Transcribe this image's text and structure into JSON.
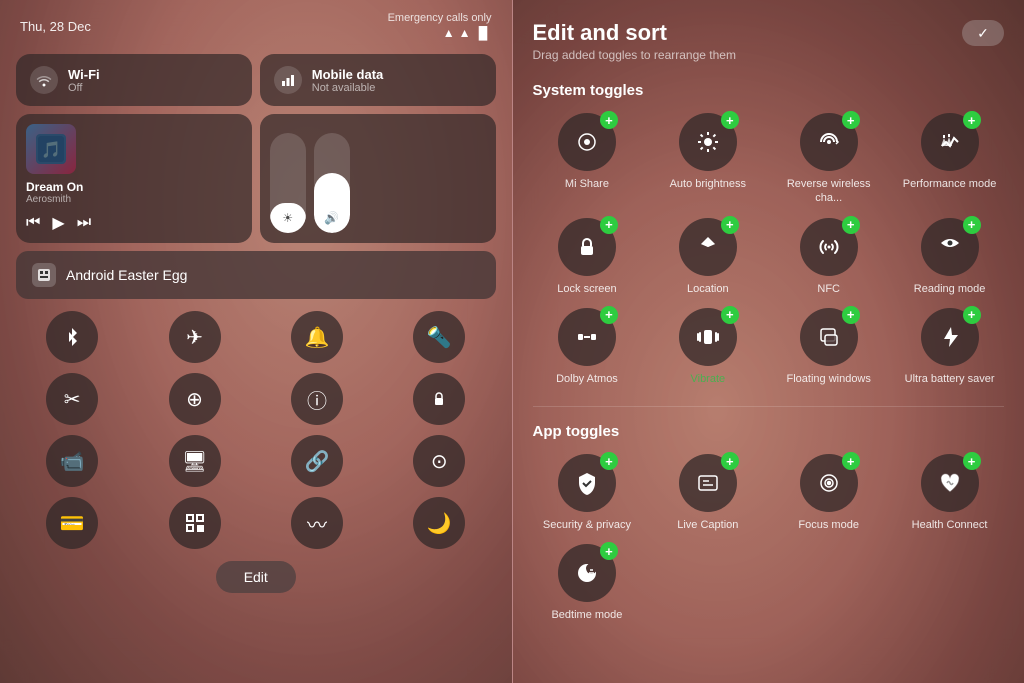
{
  "left": {
    "status": {
      "emergency": "Emergency calls only",
      "date": "Thu, 28 Dec",
      "signal_icons": "▲ ◈ ▐▌"
    },
    "connectivity": [
      {
        "id": "wifi",
        "icon": "📶",
        "name": "Wi-Fi",
        "status": "Off"
      },
      {
        "id": "mobile",
        "icon": "📱",
        "name": "Mobile data",
        "status": "Not available"
      }
    ],
    "media": {
      "song": "Dream On",
      "artist": "Aerosmith",
      "art_icon": "🎵"
    },
    "sliders": [
      {
        "id": "brightness",
        "fill_pct": 30,
        "icon": "☀"
      },
      {
        "id": "volume",
        "fill_pct": 60,
        "icon": "🔊"
      }
    ],
    "easter_egg": "Android Easter Egg",
    "toggles": [
      {
        "id": "bluetooth",
        "icon": "⛶",
        "symbol": "Ƀ"
      },
      {
        "id": "airplane",
        "icon": "✈"
      },
      {
        "id": "bell",
        "icon": "🔔"
      },
      {
        "id": "flashlight",
        "icon": "🔦"
      },
      {
        "id": "scissors",
        "icon": "✂"
      },
      {
        "id": "plus",
        "icon": "⊕"
      },
      {
        "id": "circle-i",
        "icon": "ⓘ"
      },
      {
        "id": "lock-rotate",
        "icon": "🔒"
      },
      {
        "id": "video",
        "icon": "📹"
      },
      {
        "id": "screen",
        "icon": "🖥"
      },
      {
        "id": "link",
        "icon": "🔗"
      },
      {
        "id": "circle-dot",
        "icon": "⊙"
      },
      {
        "id": "card",
        "icon": "💳"
      },
      {
        "id": "scan",
        "icon": "⬚"
      },
      {
        "id": "waves",
        "icon": "〜"
      },
      {
        "id": "moon",
        "icon": "🌙"
      }
    ],
    "edit_label": "Edit"
  },
  "right": {
    "header": {
      "title": "Edit and sort",
      "subtitle": "Drag added toggles to rearrange them",
      "check_icon": "✓"
    },
    "system_section": "System toggles",
    "system_toggles": [
      {
        "id": "mi-share",
        "icon": "👁",
        "label": "Mi Share"
      },
      {
        "id": "auto-brightness",
        "icon": "✳",
        "label": "Auto brightness"
      },
      {
        "id": "reverse-wireless",
        "icon": "⚡",
        "label": "Reverse wireless cha..."
      },
      {
        "id": "performance",
        "icon": "⬆⬆",
        "label": "Performance mode"
      },
      {
        "id": "lock-screen",
        "icon": "🔒",
        "label": "Lock screen"
      },
      {
        "id": "location",
        "icon": "◈",
        "label": "Location"
      },
      {
        "id": "nfc",
        "icon": "N",
        "label": "NFC"
      },
      {
        "id": "reading-mode",
        "icon": "👁",
        "label": "Reading mode"
      },
      {
        "id": "dolby",
        "icon": "▷◁",
        "label": "Dolby Atmos"
      },
      {
        "id": "vibrate",
        "icon": "📳",
        "label": "Vibrate"
      },
      {
        "id": "floating-windows",
        "icon": "⊡",
        "label": "Floating windows"
      },
      {
        "id": "ultra-battery",
        "icon": "⚡",
        "label": "Ultra battery saver"
      }
    ],
    "app_section": "App toggles",
    "app_toggles": [
      {
        "id": "security-privacy",
        "icon": "🛡",
        "label": "Security & privacy"
      },
      {
        "id": "live-caption",
        "icon": "⊟",
        "label": "Live Caption"
      },
      {
        "id": "focus-mode",
        "icon": "(o)",
        "label": "Focus mode"
      },
      {
        "id": "health-connect",
        "icon": "♾",
        "label": "Health Connect"
      },
      {
        "id": "bedtime-mode",
        "icon": "🌙",
        "label": "Bedtime mode"
      }
    ]
  }
}
